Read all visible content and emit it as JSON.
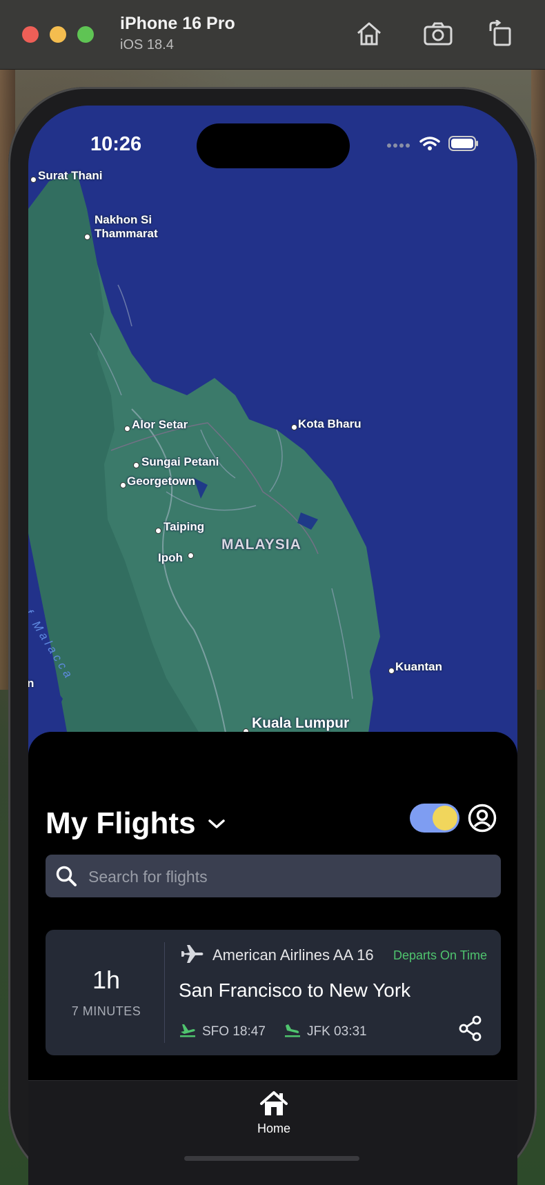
{
  "simulator": {
    "device_name": "iPhone 16 Pro",
    "os_version": "iOS 18.4",
    "icons": [
      "home-icon",
      "camera-icon",
      "rotate-icon"
    ]
  },
  "status_bar": {
    "time": "10:26",
    "icons": [
      "signal-icon",
      "wifi-icon",
      "battery-icon"
    ]
  },
  "map": {
    "labels": [
      "Surat Thani",
      "Nakhon Si",
      "Thammarat",
      "Alor Setar",
      "Kota Bharu",
      "Sungai Petani",
      "Georgetown",
      "Taiping",
      "Ipoh",
      "MALAYSIA",
      "Kuantan",
      "Kuala Lumpur",
      "of Malacca",
      "n"
    ]
  },
  "header": {
    "title": "My Flights",
    "toggle_on": true
  },
  "search": {
    "placeholder": "Search for flights"
  },
  "flight": {
    "duration_hours": "1h",
    "duration_minutes": "7 MINUTES",
    "airline": "American Airlines AA 16",
    "status": "Departs On Time",
    "route": "San Francisco to New York",
    "departure": "SFO 18:47",
    "arrival": "JFK 03:31"
  },
  "tabbar": {
    "home_label": "Home"
  },
  "colors": {
    "accent_green": "#4fc46e",
    "toggle_track": "#7e9df2",
    "toggle_knob": "#f1d65c",
    "ocean": "#22328a",
    "land": "#3b7a6a"
  }
}
